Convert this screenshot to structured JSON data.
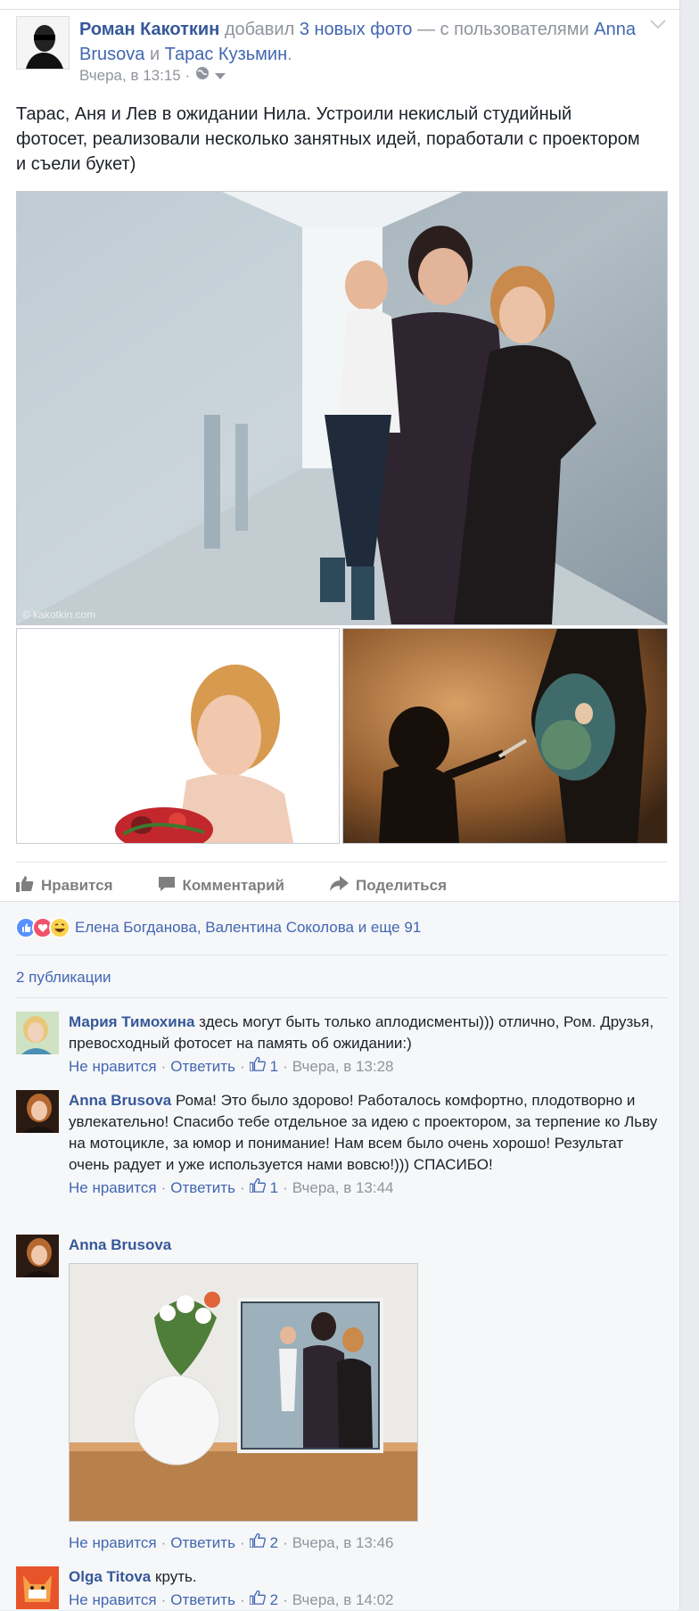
{
  "post": {
    "author": "Роман Какоткин",
    "added": "добавил",
    "photos_link": "3 новых фото",
    "with": "— с пользователями",
    "tag1": "Anna Brusova",
    "and": "и",
    "tag2": "Тарас Кузьмин",
    "dot": ".",
    "time": "Вчера, в 13:15 ·",
    "text": "Тарас, Аня и Лев в ожидании Нила. Устроили некислый студийный фотосет, реализовали несколько занятных идей, поработали с проектором и съели букет)",
    "watermark": "© kakotkin.com"
  },
  "actions": {
    "like": "Нравится",
    "comment": "Комментарий",
    "share": "Поделиться"
  },
  "likes": {
    "text": "Елена Богданова, Валентина Соколова и еще 91"
  },
  "publications": "2 публикации",
  "comments": [
    {
      "name": "Мария Тимохина",
      "text": "здесь могут быть только аплодисменты))) отлично, Ром. Друзья, превосходный фотосет на память об ожидании:)",
      "unlike": "Не нравится",
      "reply": "Ответить",
      "likes": "1",
      "time": "Вчера, в 13:28"
    },
    {
      "name": "Anna Brusova",
      "text": "Рома! Это было здорово! Работалось комфортно, плодотворно и увлекательно! Спасибо тебе отдельное за идею с проектором, за терпение ко Льву на мотоцикле, за юмор и понимание! Нам всем было очень хорошо! Результат очень радует и уже используется нами вовсю!))) СПАСИБО!",
      "unlike": "Не нравится",
      "reply": "Ответить",
      "likes": "1",
      "time": "Вчера, в 13:44"
    },
    {
      "name": "Anna Brusova",
      "text": "",
      "unlike": "Не нравится",
      "reply": "Ответить",
      "likes": "2",
      "time": "Вчера, в 13:46"
    },
    {
      "name": "Olga Titova",
      "text": "круть.",
      "unlike": "Не нравится",
      "reply": "Ответить",
      "likes": "2",
      "time": "Вчера, в 14:02"
    }
  ],
  "colors": {
    "link": "#4267b2",
    "name": "#365899",
    "meta": "#90949c",
    "text": "#1d2129"
  }
}
